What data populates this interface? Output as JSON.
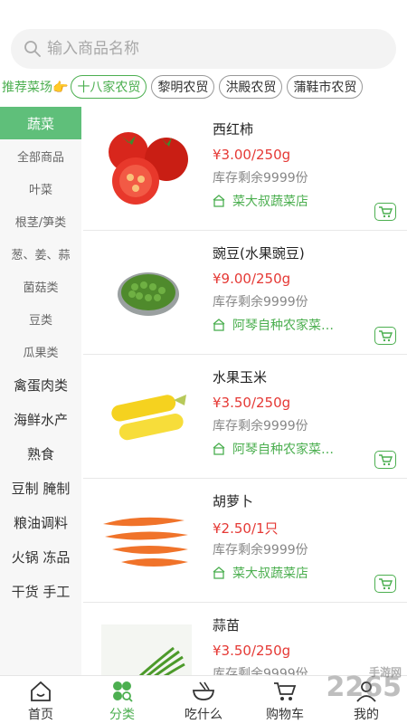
{
  "search": {
    "placeholder": "输入商品名称"
  },
  "recommend_label": "推荐菜场👉",
  "markets": [
    {
      "label": "十八家农贸",
      "active": true
    },
    {
      "label": "黎明农贸",
      "active": false
    },
    {
      "label": "洪殿农贸",
      "active": false
    },
    {
      "label": "蒲鞋市农贸",
      "active": false
    }
  ],
  "categories": [
    "蔬菜",
    "全部商品",
    "叶菜",
    "根茎/笋类",
    "葱、姜、蒜",
    "菌菇类",
    "豆类",
    "瓜果类",
    "禽蛋肉类",
    "海鲜水产",
    "熟食",
    "豆制 腌制",
    "粮油调料",
    "火锅 冻品",
    "干货 手工"
  ],
  "products": [
    {
      "name": "西红柿",
      "price": "¥3.00/250g",
      "stock": "库存剩余9999份",
      "shop": "菜大叔蔬菜店",
      "icon": "tomato-image"
    },
    {
      "name": "豌豆(水果豌豆)",
      "price": "¥9.00/250g",
      "stock": "库存剩余9999份",
      "shop": "阿琴自种农家菜…",
      "icon": "peas-image"
    },
    {
      "name": "水果玉米",
      "price": "¥3.50/250g",
      "stock": "库存剩余9999份",
      "shop": "阿琴自种农家菜…",
      "icon": "corn-image"
    },
    {
      "name": "胡萝卜",
      "price": "¥2.50/1只",
      "stock": "库存剩余9999份",
      "shop": "菜大叔蔬菜店",
      "icon": "carrot-image"
    },
    {
      "name": "蒜苗",
      "price": "¥3.50/250g",
      "stock": "库存剩余9999份",
      "shop": "",
      "icon": "garlic-sprout-image"
    }
  ],
  "nav": [
    {
      "label": "首页",
      "icon": "home-icon"
    },
    {
      "label": "分类",
      "icon": "category-icon",
      "active": true
    },
    {
      "label": "吃什么",
      "icon": "bowl-icon"
    },
    {
      "label": "购物车",
      "icon": "cart-icon"
    },
    {
      "label": "我的",
      "icon": "user-icon"
    }
  ],
  "watermark": {
    "text": "2265",
    "sub": "手游网"
  },
  "colors": {
    "accent": "#4caf50",
    "price": "#e53935",
    "active_category": "#5fbf7a"
  }
}
